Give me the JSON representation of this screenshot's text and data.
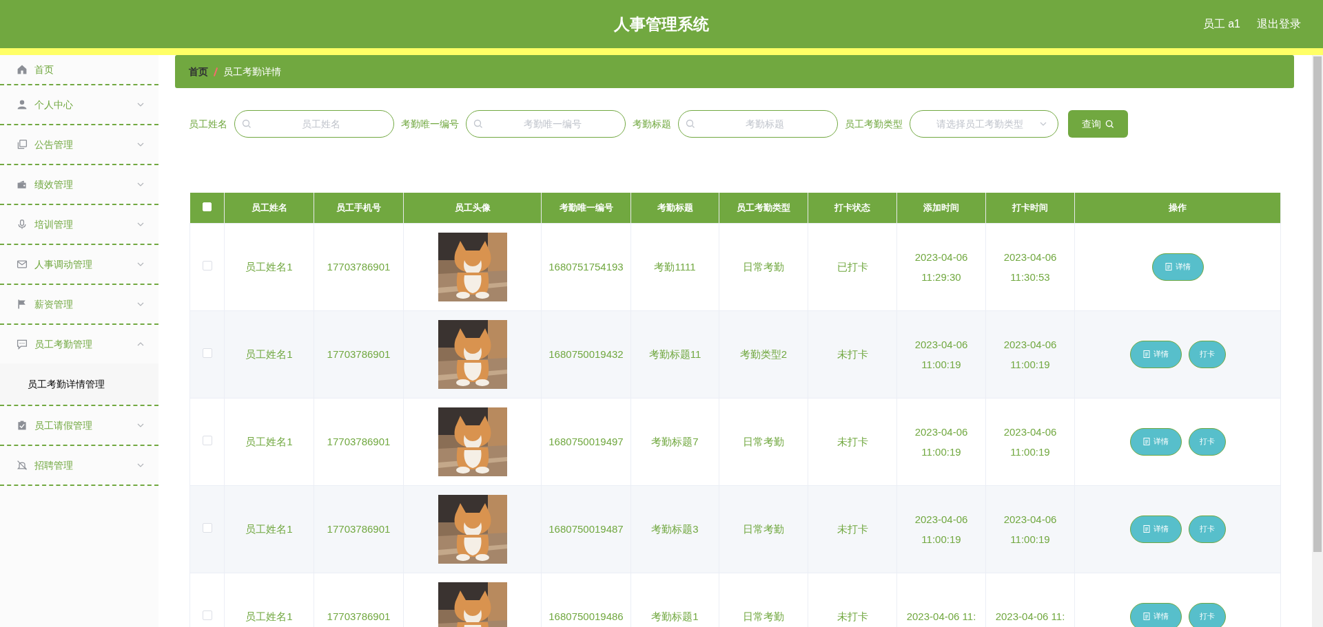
{
  "header": {
    "title": "人事管理系统",
    "user": "员工 a1",
    "logout": "退出登录"
  },
  "sidebar": {
    "items": [
      {
        "label": "首页",
        "kind": "link"
      },
      {
        "label": "个人中心",
        "kind": "menu",
        "expanded": false
      },
      {
        "label": "公告管理",
        "kind": "menu",
        "expanded": false
      },
      {
        "label": "绩效管理",
        "kind": "menu",
        "expanded": false
      },
      {
        "label": "培训管理",
        "kind": "menu",
        "expanded": false
      },
      {
        "label": "人事调动管理",
        "kind": "menu",
        "expanded": false
      },
      {
        "label": "薪资管理",
        "kind": "menu",
        "expanded": false
      },
      {
        "label": "员工考勤管理",
        "kind": "menu",
        "expanded": true,
        "children": [
          {
            "label": "员工考勤详情管理",
            "selected": true
          }
        ]
      },
      {
        "label": "员工请假管理",
        "kind": "menu",
        "expanded": false
      },
      {
        "label": "招聘管理",
        "kind": "menu",
        "expanded": false
      }
    ]
  },
  "breadcrumb": [
    "首页",
    "员工考勤详情"
  ],
  "search": {
    "fields": [
      {
        "label": "员工姓名",
        "placeholder": "员工姓名",
        "kind": "text"
      },
      {
        "label": "考勤唯一编号",
        "placeholder": "考勤唯一编号",
        "kind": "text"
      },
      {
        "label": "考勤标题",
        "placeholder": "考勤标题",
        "kind": "text"
      },
      {
        "label": "员工考勤类型",
        "placeholder": "请选择员工考勤类型",
        "kind": "select"
      }
    ],
    "button": "查询"
  },
  "table": {
    "select_all": {
      "checked": false
    },
    "columns": [
      "员工姓名",
      "员工手机号",
      "员工头像",
      "考勤唯一编号",
      "考勤标题",
      "员工考勤类型",
      "打卡状态",
      "添加时间",
      "打卡时间",
      "操作"
    ],
    "rows": [
      {
        "checked": false,
        "name": "员工姓名1",
        "phone": "17703786901",
        "avatar": {
          "kind": "picture"
        },
        "code": "1680751754193",
        "title": "考勤1111",
        "type": "日常考勤",
        "status": "已打卡",
        "added": "2023-04-06 11:29:30",
        "clocked": "2023-04-06 11:30:53",
        "actions": [
          "详情"
        ]
      },
      {
        "checked": false,
        "name": "员工姓名1",
        "phone": "17703786901",
        "avatar": {
          "kind": "picture"
        },
        "code": "1680750019432",
        "title": "考勤标题11",
        "type": "考勤类型2",
        "status": "未打卡",
        "added": "2023-04-06 11:00:19",
        "clocked": "2023-04-06 11:00:19",
        "actions": [
          "详情",
          "打卡"
        ]
      },
      {
        "checked": false,
        "name": "员工姓名1",
        "phone": "17703786901",
        "avatar": {
          "kind": "picture"
        },
        "code": "1680750019497",
        "title": "考勤标题7",
        "type": "日常考勤",
        "status": "未打卡",
        "added": "2023-04-06 11:00:19",
        "clocked": "2023-04-06 11:00:19",
        "actions": [
          "详情",
          "打卡"
        ]
      },
      {
        "checked": false,
        "name": "员工姓名1",
        "phone": "17703786901",
        "avatar": {
          "kind": "picture"
        },
        "code": "1680750019487",
        "title": "考勤标题3",
        "type": "日常考勤",
        "status": "未打卡",
        "added": "2023-04-06 11:00:19",
        "clocked": "2023-04-06 11:00:19",
        "actions": [
          "详情",
          "打卡"
        ]
      },
      {
        "checked": false,
        "name": "员工姓名1",
        "phone": "17703786901",
        "avatar": {
          "kind": "picture"
        },
        "code": "1680750019486",
        "title": "考勤标题1",
        "type": "日常考勤",
        "status": "未打卡",
        "added": "2023-04-06 11:",
        "clocked": "2023-04-06 11:",
        "actions": [
          "详情",
          "打卡"
        ]
      }
    ]
  }
}
